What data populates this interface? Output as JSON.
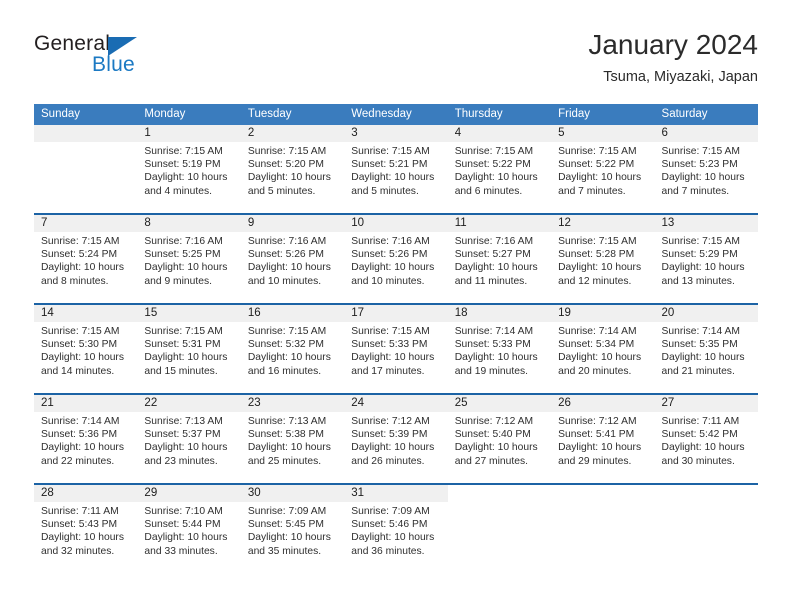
{
  "brand": {
    "name_part1": "General",
    "name_part2": "Blue",
    "accent_color": "#1a6cb3"
  },
  "header": {
    "title": "January 2024",
    "subtitle": "Tsuma, Miyazaki, Japan"
  },
  "calendar": {
    "header_bg": "#3a7cbe",
    "separator_color": "#1c63a5",
    "daynum_bg": "#f0f0f0",
    "weekdays": [
      "Sunday",
      "Monday",
      "Tuesday",
      "Wednesday",
      "Thursday",
      "Friday",
      "Saturday"
    ],
    "weeks": [
      [
        {
          "day": "",
          "lines": []
        },
        {
          "day": "1",
          "lines": [
            "Sunrise: 7:15 AM",
            "Sunset: 5:19 PM",
            "Daylight: 10 hours",
            "and 4 minutes."
          ]
        },
        {
          "day": "2",
          "lines": [
            "Sunrise: 7:15 AM",
            "Sunset: 5:20 PM",
            "Daylight: 10 hours",
            "and 5 minutes."
          ]
        },
        {
          "day": "3",
          "lines": [
            "Sunrise: 7:15 AM",
            "Sunset: 5:21 PM",
            "Daylight: 10 hours",
            "and 5 minutes."
          ]
        },
        {
          "day": "4",
          "lines": [
            "Sunrise: 7:15 AM",
            "Sunset: 5:22 PM",
            "Daylight: 10 hours",
            "and 6 minutes."
          ]
        },
        {
          "day": "5",
          "lines": [
            "Sunrise: 7:15 AM",
            "Sunset: 5:22 PM",
            "Daylight: 10 hours",
            "and 7 minutes."
          ]
        },
        {
          "day": "6",
          "lines": [
            "Sunrise: 7:15 AM",
            "Sunset: 5:23 PM",
            "Daylight: 10 hours",
            "and 7 minutes."
          ]
        }
      ],
      [
        {
          "day": "7",
          "lines": [
            "Sunrise: 7:15 AM",
            "Sunset: 5:24 PM",
            "Daylight: 10 hours",
            "and 8 minutes."
          ]
        },
        {
          "day": "8",
          "lines": [
            "Sunrise: 7:16 AM",
            "Sunset: 5:25 PM",
            "Daylight: 10 hours",
            "and 9 minutes."
          ]
        },
        {
          "day": "9",
          "lines": [
            "Sunrise: 7:16 AM",
            "Sunset: 5:26 PM",
            "Daylight: 10 hours",
            "and 10 minutes."
          ]
        },
        {
          "day": "10",
          "lines": [
            "Sunrise: 7:16 AM",
            "Sunset: 5:26 PM",
            "Daylight: 10 hours",
            "and 10 minutes."
          ]
        },
        {
          "day": "11",
          "lines": [
            "Sunrise: 7:16 AM",
            "Sunset: 5:27 PM",
            "Daylight: 10 hours",
            "and 11 minutes."
          ]
        },
        {
          "day": "12",
          "lines": [
            "Sunrise: 7:15 AM",
            "Sunset: 5:28 PM",
            "Daylight: 10 hours",
            "and 12 minutes."
          ]
        },
        {
          "day": "13",
          "lines": [
            "Sunrise: 7:15 AM",
            "Sunset: 5:29 PM",
            "Daylight: 10 hours",
            "and 13 minutes."
          ]
        }
      ],
      [
        {
          "day": "14",
          "lines": [
            "Sunrise: 7:15 AM",
            "Sunset: 5:30 PM",
            "Daylight: 10 hours",
            "and 14 minutes."
          ]
        },
        {
          "day": "15",
          "lines": [
            "Sunrise: 7:15 AM",
            "Sunset: 5:31 PM",
            "Daylight: 10 hours",
            "and 15 minutes."
          ]
        },
        {
          "day": "16",
          "lines": [
            "Sunrise: 7:15 AM",
            "Sunset: 5:32 PM",
            "Daylight: 10 hours",
            "and 16 minutes."
          ]
        },
        {
          "day": "17",
          "lines": [
            "Sunrise: 7:15 AM",
            "Sunset: 5:33 PM",
            "Daylight: 10 hours",
            "and 17 minutes."
          ]
        },
        {
          "day": "18",
          "lines": [
            "Sunrise: 7:14 AM",
            "Sunset: 5:33 PM",
            "Daylight: 10 hours",
            "and 19 minutes."
          ]
        },
        {
          "day": "19",
          "lines": [
            "Sunrise: 7:14 AM",
            "Sunset: 5:34 PM",
            "Daylight: 10 hours",
            "and 20 minutes."
          ]
        },
        {
          "day": "20",
          "lines": [
            "Sunrise: 7:14 AM",
            "Sunset: 5:35 PM",
            "Daylight: 10 hours",
            "and 21 minutes."
          ]
        }
      ],
      [
        {
          "day": "21",
          "lines": [
            "Sunrise: 7:14 AM",
            "Sunset: 5:36 PM",
            "Daylight: 10 hours",
            "and 22 minutes."
          ]
        },
        {
          "day": "22",
          "lines": [
            "Sunrise: 7:13 AM",
            "Sunset: 5:37 PM",
            "Daylight: 10 hours",
            "and 23 minutes."
          ]
        },
        {
          "day": "23",
          "lines": [
            "Sunrise: 7:13 AM",
            "Sunset: 5:38 PM",
            "Daylight: 10 hours",
            "and 25 minutes."
          ]
        },
        {
          "day": "24",
          "lines": [
            "Sunrise: 7:12 AM",
            "Sunset: 5:39 PM",
            "Daylight: 10 hours",
            "and 26 minutes."
          ]
        },
        {
          "day": "25",
          "lines": [
            "Sunrise: 7:12 AM",
            "Sunset: 5:40 PM",
            "Daylight: 10 hours",
            "and 27 minutes."
          ]
        },
        {
          "day": "26",
          "lines": [
            "Sunrise: 7:12 AM",
            "Sunset: 5:41 PM",
            "Daylight: 10 hours",
            "and 29 minutes."
          ]
        },
        {
          "day": "27",
          "lines": [
            "Sunrise: 7:11 AM",
            "Sunset: 5:42 PM",
            "Daylight: 10 hours",
            "and 30 minutes."
          ]
        }
      ],
      [
        {
          "day": "28",
          "lines": [
            "Sunrise: 7:11 AM",
            "Sunset: 5:43 PM",
            "Daylight: 10 hours",
            "and 32 minutes."
          ]
        },
        {
          "day": "29",
          "lines": [
            "Sunrise: 7:10 AM",
            "Sunset: 5:44 PM",
            "Daylight: 10 hours",
            "and 33 minutes."
          ]
        },
        {
          "day": "30",
          "lines": [
            "Sunrise: 7:09 AM",
            "Sunset: 5:45 PM",
            "Daylight: 10 hours",
            "and 35 minutes."
          ]
        },
        {
          "day": "31",
          "lines": [
            "Sunrise: 7:09 AM",
            "Sunset: 5:46 PM",
            "Daylight: 10 hours",
            "and 36 minutes."
          ]
        },
        {
          "day": "",
          "lines": []
        },
        {
          "day": "",
          "lines": []
        },
        {
          "day": "",
          "lines": []
        }
      ]
    ]
  }
}
